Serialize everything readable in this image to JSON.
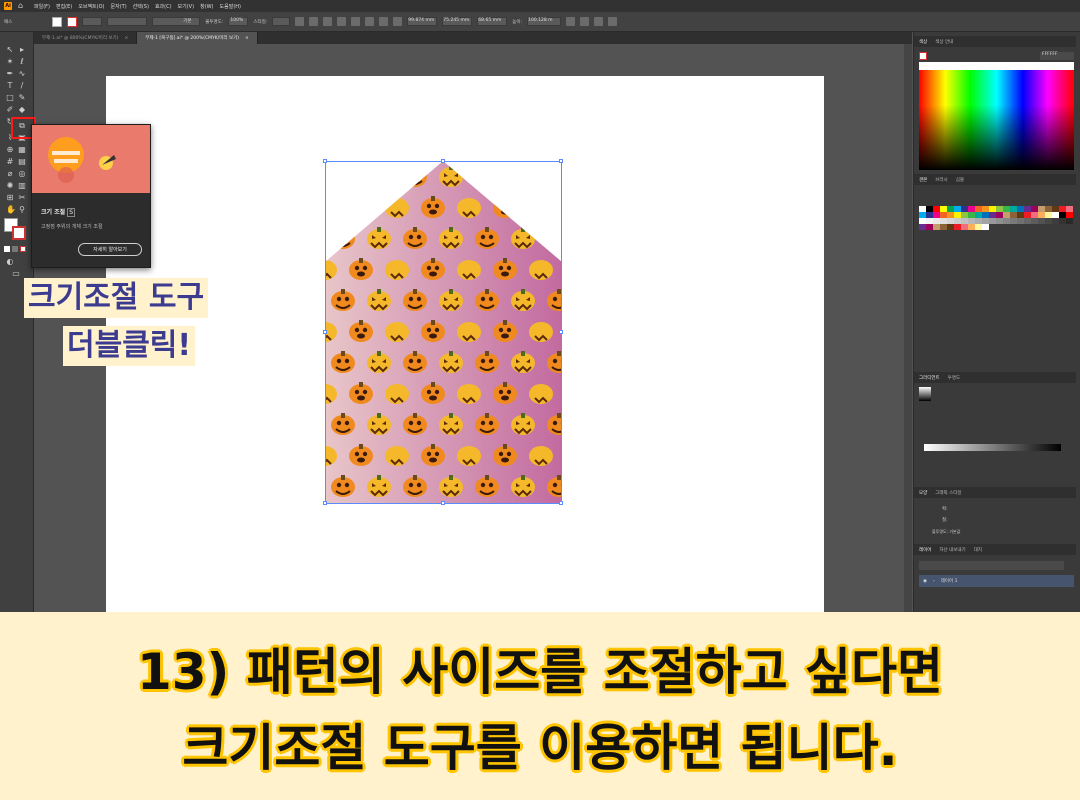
{
  "app": {
    "logo_text": "Ai"
  },
  "menu": [
    "파일(F)",
    "편집(E)",
    "오브젝트(O)",
    "문자(T)",
    "선택(S)",
    "효과(C)",
    "보기(V)",
    "창(W)",
    "도움말(H)"
  ],
  "control_bar": {
    "object_label": "패스",
    "stroke_style": "기본",
    "opacity_label": "불투명도:",
    "opacity_value": "100%",
    "style_label": "스타일:",
    "x_value": "99.874 mm",
    "y_value": "75.245 mm",
    "width_value": "68.65 mm",
    "height_label": "높이:",
    "height_value": "100.128 m"
  },
  "tabs": [
    {
      "label": "무제-1.ai* @ 800%(CMYK/미리 보기)",
      "close": "×"
    },
    {
      "label": "무제-1 [복구됨].ai* @ 200%(CMYK/미리 보기)",
      "close": "×"
    }
  ],
  "tooltip": {
    "title": "크기 조절",
    "shortcut": "S",
    "description": "고정점 주위의 개체 크기 조절",
    "button": "자세히 알아보기"
  },
  "callout": {
    "line1": "크기조절 도구",
    "line2": "더블클릭!"
  },
  "right_panel": {
    "color_tabs": [
      "색상",
      "색상 안내"
    ],
    "hex_value": "FFFFFF",
    "swatch_tabs": [
      "견본",
      "브러시",
      "심볼"
    ],
    "gradient_tabs": [
      "그라디언트",
      "투명도"
    ],
    "appearance_tabs": [
      "모양",
      "그래픽 스타일"
    ],
    "appearance_rows": [
      {
        "label": "획:"
      },
      {
        "label": "칠:"
      }
    ],
    "appearance_opacity": "불투명도: 기본값",
    "layers_tabs": [
      "레이어",
      "자산 내보내기",
      "대지"
    ],
    "layer_name": "레이어 1"
  },
  "caption": {
    "line1": "13) 패턴의 사이즈를 조절하고 싶다면",
    "line2": "크기조절 도구를 이용하면 됩니다."
  },
  "colors": {
    "caption_bg": "#fff2cc",
    "caption_outline": "#ffc400",
    "highlight": "#ff1a1a",
    "callout_text": "#3b3b8f"
  }
}
